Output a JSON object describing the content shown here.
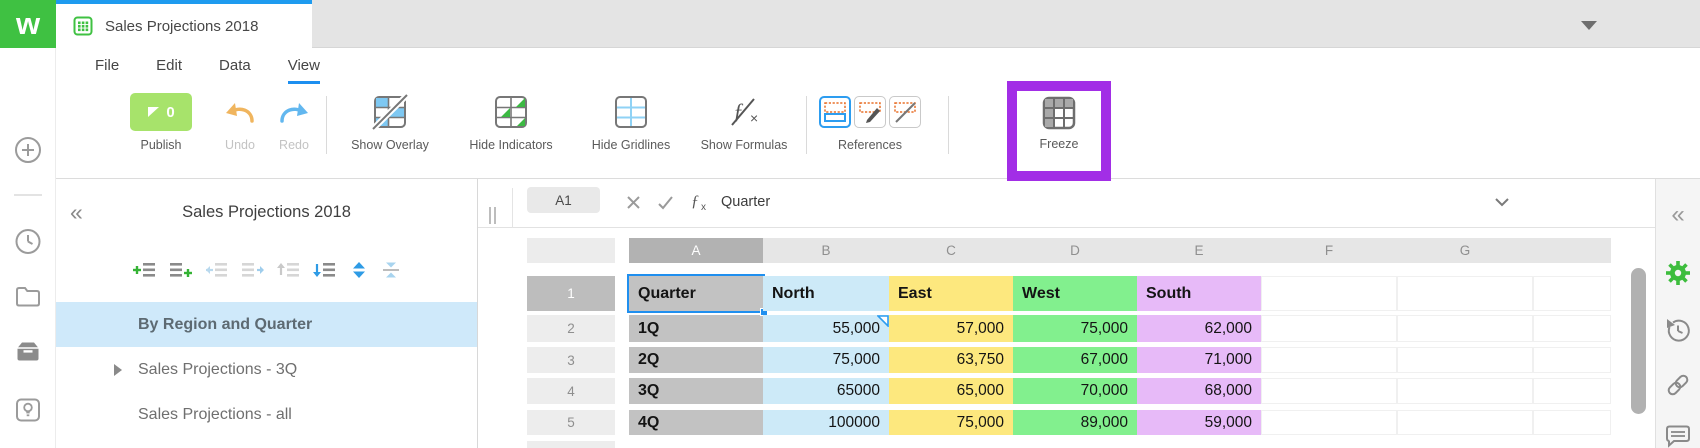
{
  "brand": {
    "logo_letter": "w",
    "green": "#3fc142",
    "blue": "#1e9bef",
    "annotation_purple": "#a22ee6"
  },
  "tab_bar": {
    "tab_title": "Sales Projections 2018"
  },
  "menu": {
    "items": [
      "File",
      "Edit",
      "Data",
      "View"
    ],
    "active": "View"
  },
  "toolbar": {
    "publish_label": "Publish",
    "publish_count": "0",
    "undo_label": "Undo",
    "redo_label": "Redo",
    "show_overlay_label": "Show Overlay",
    "hide_indicators_label": "Hide Indicators",
    "hide_gridlines_label": "Hide Gridlines",
    "show_formulas_label": "Show Formulas",
    "references_label": "References",
    "freeze_label": "Freeze"
  },
  "glyphs": {
    "panel_collapse": "«",
    "rail_collapse": "«"
  },
  "sheet_panel": {
    "title": "Sales Projections 2018",
    "items": [
      {
        "label": "By Region and Quarter",
        "selected": true
      },
      {
        "label": "Sales Projections - 3Q",
        "selected": false,
        "has_caret": true
      },
      {
        "label": "Sales Projections - all",
        "selected": false
      }
    ]
  },
  "formula_bar": {
    "cell_ref": "A1",
    "content": "Quarter"
  },
  "spreadsheet": {
    "selected_cell": "A1",
    "col_headers": [
      "A",
      "B",
      "C",
      "D",
      "E",
      "F",
      "G"
    ],
    "row_headers": [
      "1",
      "2",
      "3",
      "4",
      "5"
    ],
    "cells": {
      "r1": [
        "Quarter",
        "North",
        "East",
        "West",
        "South"
      ],
      "r2": [
        "1Q",
        "55,000",
        "57,000",
        "75,000",
        "62,000"
      ],
      "r3": [
        "2Q",
        "75,000",
        "63,750",
        "67,000",
        "71,000"
      ],
      "r4": [
        "3Q",
        "65000",
        "65,000",
        "70,000",
        "68,000"
      ],
      "r5": [
        "4Q",
        "100000",
        "75,000",
        "89,000",
        "59,000"
      ]
    },
    "column_colors": {
      "A": "#c2c2c2",
      "B": "#cdeaf8",
      "C": "#fde87e",
      "D": "#82f08e",
      "E": "#e7baf8"
    }
  }
}
